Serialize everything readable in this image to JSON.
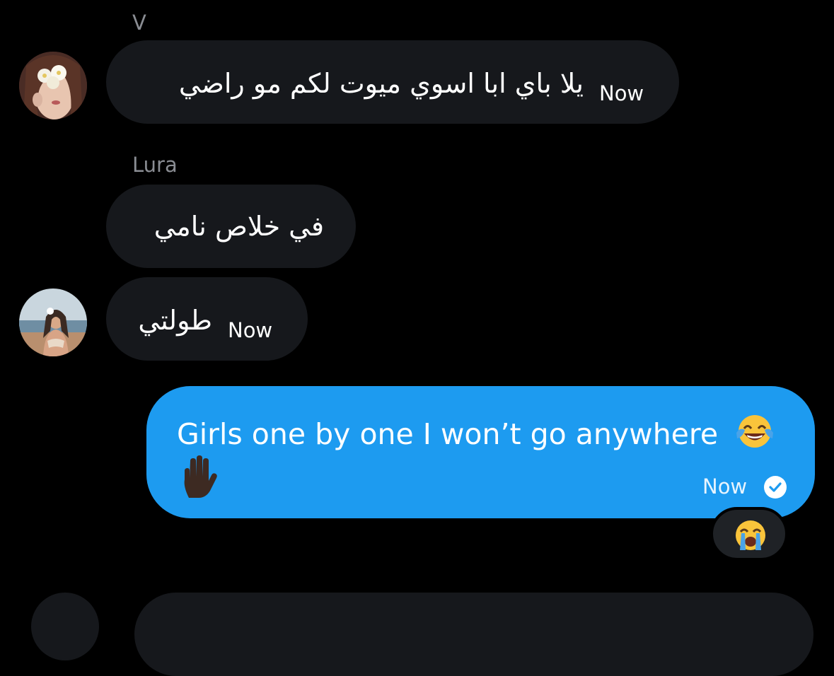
{
  "messages": [
    {
      "sender": "V",
      "text": "يلا باي ابا اسوي ميوت لكم مو راضي",
      "time": "Now",
      "avatar_icon": "avatar-flower-face"
    },
    {
      "sender": "Lura",
      "text": "في خلاص نامي",
      "time": "",
      "avatar_icon": ""
    },
    {
      "sender": "",
      "text": "طولتي",
      "time": "Now",
      "avatar_icon": "avatar-beach-girl"
    }
  ],
  "outgoing": {
    "text": "Girls one by one I won’t go anywhere",
    "emoji_inline": "face-with-tears-of-joy",
    "emoji_second_line": "raised-hand-dark",
    "time": "Now",
    "status_icon": "read-check-icon",
    "reaction_icon": "loudly-crying-face",
    "bubble_color": "#1d9bf0"
  },
  "colors": {
    "background": "#000000",
    "incoming_bubble": "#16181c",
    "sender_label": "#8a8d93",
    "text": "#ffffff"
  }
}
